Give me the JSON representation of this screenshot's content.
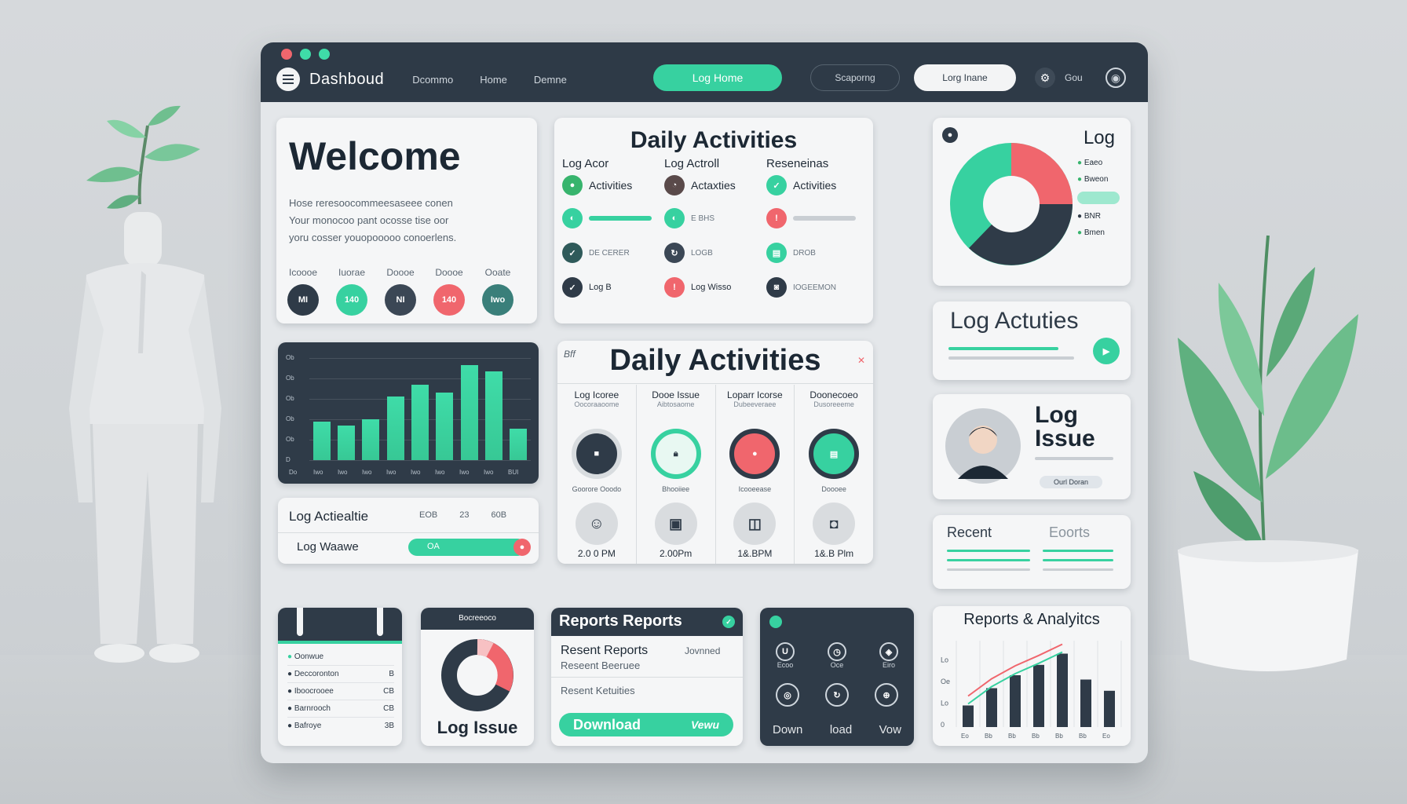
{
  "topbar": {
    "brand": "Dashboud",
    "links": [
      "Dcommo",
      "Home",
      "Demne"
    ],
    "primary_btn": "Log Home",
    "outline_btn": "Scaporng",
    "light_btn": "Lorg Inane",
    "user_label": "Gou"
  },
  "welcome": {
    "title": "Welcome",
    "lines": [
      "Hose reresoocommeesaseee conen",
      "Your monocoo pant ocosse tise oor",
      "yoru cosser youopooooo conoerlens."
    ],
    "stats": [
      {
        "label": "Icoooe",
        "value": "MI",
        "color": "#2f3b48"
      },
      {
        "label": "Iuorae",
        "value": "140",
        "color": "#37d1a0"
      },
      {
        "label": "Doooe",
        "value": "NI",
        "color": "#3b4755"
      },
      {
        "label": "Doooe",
        "value": "140",
        "color": "#f0666d"
      },
      {
        "label": "Ooate",
        "value": "Iwo",
        "color": "#3a7f7a"
      }
    ]
  },
  "daily_top": {
    "title": "Daily Activities",
    "columns": [
      {
        "header": "Log Acor",
        "sub": "Activities",
        "rows": [
          "Activities",
          "",
          "DE CERER",
          "Log B"
        ]
      },
      {
        "header": "Log Actroll",
        "sub": "Actaxties",
        "rows": [
          "Actaxties",
          "E BHS",
          "LOGB",
          "Log Wisso"
        ]
      },
      {
        "header": "Reseneinas",
        "sub": "Activities",
        "rows": [
          "Activities",
          "",
          "DROB",
          "IOGEEMON"
        ]
      }
    ]
  },
  "log_pie": {
    "title": "Log",
    "legend": [
      "Eaeo",
      "Bweon",
      "",
      "BNR",
      "Bmen"
    ]
  },
  "bar_chart": {
    "x_labels": [
      "Do",
      "Iwo",
      "Iwo",
      "Iwo",
      "Iwo",
      "Iwo",
      "Iwo",
      "Iwo",
      "Iwo",
      "BUI"
    ],
    "values": [
      0.38,
      0.34,
      0.4,
      0.62,
      0.74,
      0.66,
      0.93,
      0.87,
      0.31
    ],
    "y_labels": [
      "D",
      "Ob",
      "Ob",
      "Ob",
      "Ob",
      "Ob"
    ]
  },
  "log_acts_card": {
    "title": "Log Actiealtie",
    "stats": [
      "EOB",
      "23",
      "60B"
    ],
    "row_label": "Log Waawe",
    "btn_label": "OA"
  },
  "daily_mid": {
    "title": "Daily Activities",
    "badge": "Bff",
    "columns": [
      {
        "header": "Log Icoree",
        "sub": "Oocoraaoome",
        "caption": "Goorore Ooodo",
        "time": "2.0 0 PM"
      },
      {
        "header": "Dooe Issue",
        "sub": "Aibtosaome",
        "caption": "Bhooiiee",
        "time": "2.00Pm"
      },
      {
        "header": "Loparr Icorse",
        "sub": "Dubeeveraee",
        "caption": "Icooeease",
        "time": "1&.BPM"
      },
      {
        "header": "Doonecoeo",
        "sub": "Dusoreeeme",
        "caption": "Doooee",
        "time": "1&.B Plm"
      }
    ]
  },
  "log_actuties": {
    "title": "Log Actuties"
  },
  "log_issue_card": {
    "title_1": "Log",
    "title_2": "Issue",
    "btn": "Ourl Doran"
  },
  "recent": {
    "left": "Recent",
    "right": "Eoorts"
  },
  "calendar": {
    "items": [
      "Oonwue",
      "Deccoronton",
      "Iboocrooee",
      "Barnrooch",
      "Bafroye"
    ],
    "values": [
      "",
      "B",
      "CB",
      "CB",
      "3B"
    ]
  },
  "log_issue_donut": {
    "header": "Bocreeoco",
    "title": "Log Issue"
  },
  "reports": {
    "title": "Reports Reports",
    "line1": "Resent Reports",
    "line1_right": "Jovnned",
    "line2": "Reseent Beeruee",
    "line3": "Resent Ketuities",
    "download": "Download",
    "view": "Vewu"
  },
  "download_card": {
    "labels_top": [
      "Ecoo",
      "Oce",
      "Eiro"
    ],
    "labels_bottom": [
      "Down",
      "load",
      "Vow"
    ]
  },
  "analytics": {
    "title": "Reports & Analyitcs",
    "values": [
      0.25,
      0.45,
      0.6,
      0.72,
      0.85,
      0.55,
      0.42
    ],
    "y_labels": [
      "0",
      "Lo",
      "Oe",
      "Lo"
    ],
    "x_labels": [
      "Eo",
      "Bb",
      "Bb",
      "Bb",
      "Bb",
      "Bb",
      "Eo"
    ]
  },
  "colors": {
    "accent": "#37d1a0",
    "navy": "#2e3a47",
    "coral": "#f0666d"
  }
}
